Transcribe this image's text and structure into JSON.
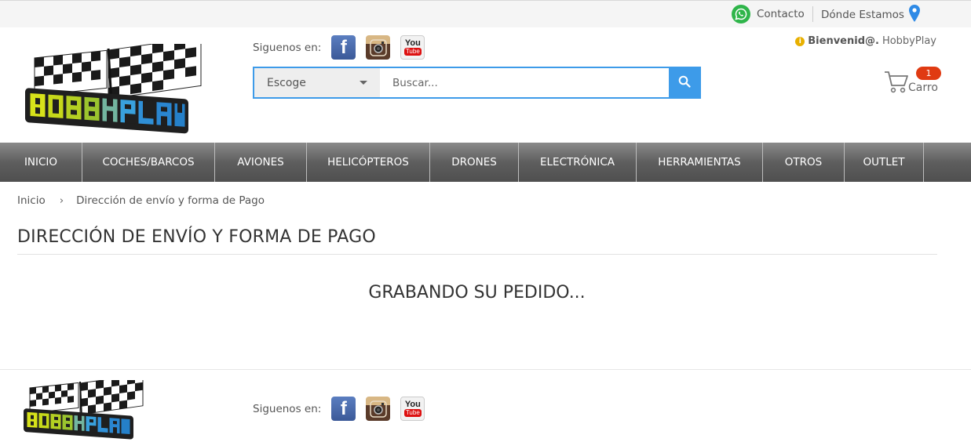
{
  "topbar": {
    "contact_label": "Contacto",
    "donde_label": "Dónde Estamos"
  },
  "header": {
    "social_label": "Siguenos en:",
    "search_category": "Escoge",
    "search_placeholder": "Buscar...",
    "welcome_strong": "Bienvenid@.",
    "welcome_user": "HobbyPlay",
    "cart_label": "Carro",
    "cart_count": "1"
  },
  "nav": {
    "items": [
      "INICIO",
      "COCHES/BARCOS",
      "AVIONES",
      "HELICÓPTEROS",
      "DRONES",
      "ELECTRÓNICA",
      "HERRAMIENTAS",
      "OTROS",
      "OUTLET"
    ]
  },
  "breadcrumb": {
    "home": "Inicio",
    "separator": "›",
    "current": "Dirección de envío y forma de Pago"
  },
  "main": {
    "title": "DIRECCIÓN DE ENVÍO Y FORMA DE PAGO",
    "status": "GRABANDO SU PEDIDO..."
  },
  "footer": {
    "social_label": "Siguenos en:"
  },
  "icons": {
    "whatsapp": "whatsapp-icon",
    "map_pin": "map-pin-icon",
    "facebook": "facebook-icon",
    "instagram": "instagram-icon",
    "youtube": "youtube-icon",
    "search": "search-icon",
    "cart": "cart-icon",
    "info": "info-icon"
  },
  "colors": {
    "accent_blue": "#3d9be9",
    "nav_dark": "#5e5e5e",
    "badge_red": "#e03a12",
    "whatsapp_green": "#2fb54a"
  }
}
